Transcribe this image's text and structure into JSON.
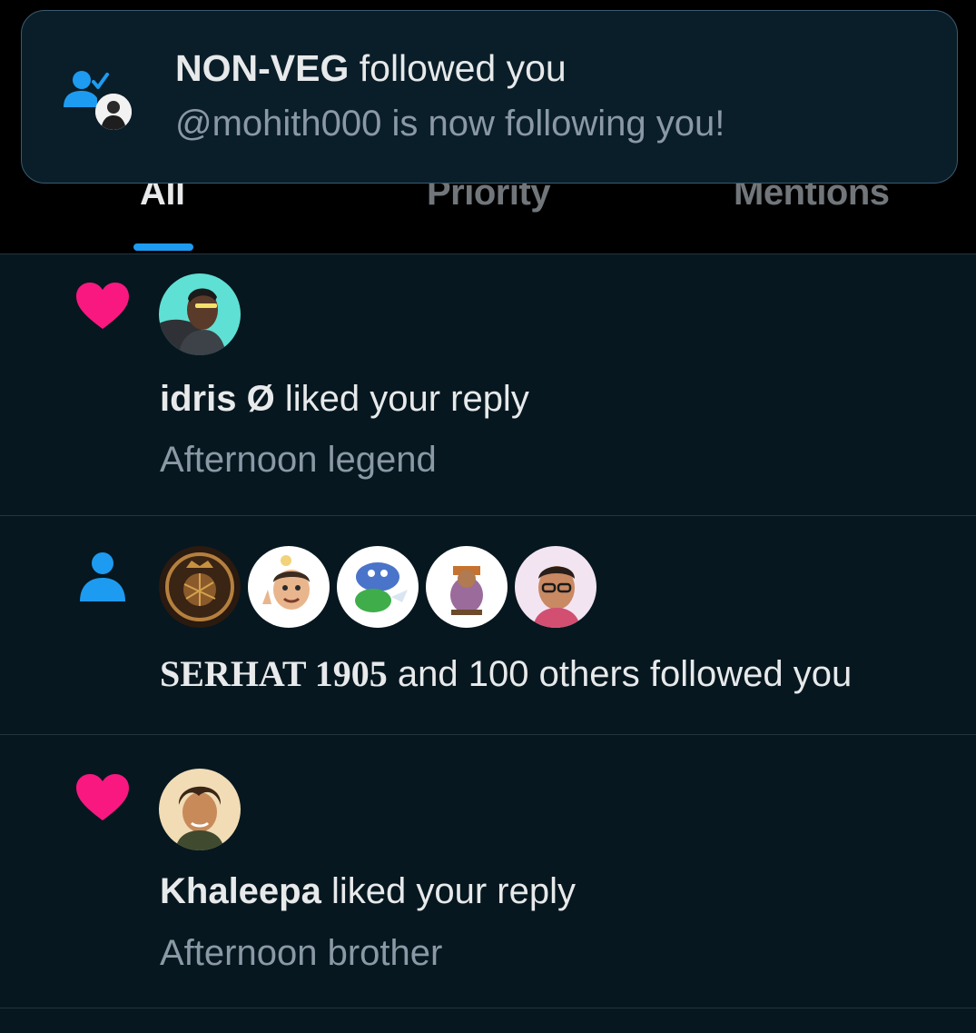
{
  "tabs": [
    {
      "label": "All",
      "active": true
    },
    {
      "label": "Priority",
      "active": false
    },
    {
      "label": "Mentions",
      "active": false
    }
  ],
  "toast": {
    "name": "NON-VEG",
    "action": " followed you",
    "subtitle": "@mohith000 is now following you!",
    "icon": "follow-check-icon"
  },
  "notifications": [
    {
      "type_icon": "heart-icon",
      "name": "idris Ø",
      "action": " liked your reply",
      "subtitle": "Afternoon legend"
    },
    {
      "type_icon": "person-icon",
      "name": "SERHAT 1905",
      "action": " and 100 others followed you"
    },
    {
      "type_icon": "heart-icon",
      "name": "Khaleepa",
      "action": " liked your reply",
      "subtitle": "Afternoon brother"
    }
  ],
  "colors": {
    "accent": "#1d9bf0",
    "like": "#f91880",
    "background": "#06171f",
    "secondary_text": "#8b98a5"
  }
}
